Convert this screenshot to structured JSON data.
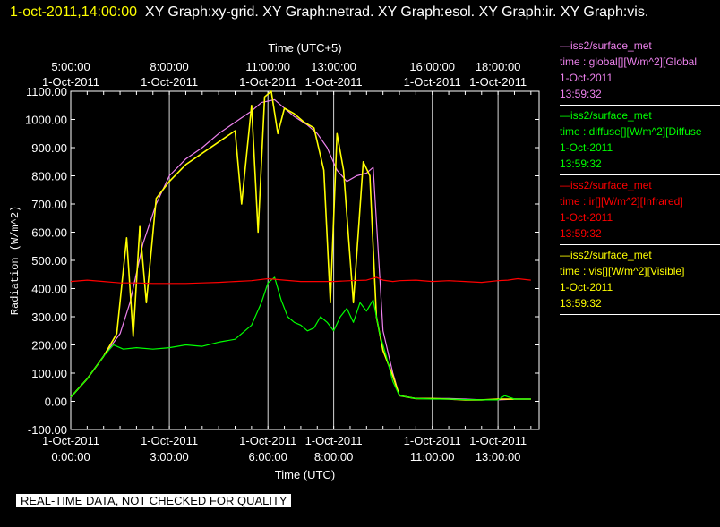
{
  "header": {
    "timestamp": "1-oct-2011,14:00:00",
    "graphs": "XY Graph:xy-grid.  XY Graph:netrad.  XY Graph:esol.  XY Graph:ir.  XY Graph:vis."
  },
  "colors": {
    "global": "#ee82ee",
    "diffuse": "#00ff00",
    "ir": "#ff0000",
    "vis": "#ffff00",
    "grid": "#ffffff",
    "background": "#000000"
  },
  "legend": [
    {
      "source": "—iss2/surface_met",
      "field": "time : global[][W/m^2][Global",
      "date": "1-Oct-2011",
      "time": "13:59:32"
    },
    {
      "source": "—iss2/surface_met",
      "field": "time : diffuse[][W/m^2][Diffuse",
      "date": "1-Oct-2011",
      "time": "13:59:32"
    },
    {
      "source": "—iss2/surface_met",
      "field": "time : ir[][W/m^2][Infrared]",
      "date": "1-Oct-2011",
      "time": "13:59:32"
    },
    {
      "source": "—iss2/surface_met",
      "field": "time : vis[][W/m^2][Visible]",
      "date": "1-Oct-2011",
      "time": "13:59:32"
    }
  ],
  "footer": "REAL-TIME DATA, NOT CHECKED FOR QUALITY",
  "chart_data": {
    "type": "line",
    "top_axis_title": "Time (UTC+5)",
    "xlabel": "Time (UTC)",
    "ylabel": "Radiation (W/m^2)",
    "ylim": [
      -100,
      1100
    ],
    "yticks": [
      "1100.00",
      "1000.00",
      "900.00",
      "800.00",
      "700.00",
      "600.00",
      "500.00",
      "400.00",
      "300.00",
      "200.00",
      "100.00",
      "0.00",
      "-100.00"
    ],
    "ytick_values": [
      1100,
      1000,
      900,
      800,
      700,
      600,
      500,
      400,
      300,
      200,
      100,
      0,
      -100
    ],
    "xlim_hours": [
      0,
      14.25
    ],
    "bottom_ticks": [
      {
        "h": 0,
        "date": "1-Oct-2011",
        "time": "0:00:00"
      },
      {
        "h": 3,
        "date": "1-Oct-2011",
        "time": "3:00:00"
      },
      {
        "h": 6,
        "date": "1-Oct-2011",
        "time": "6:00:00"
      },
      {
        "h": 8,
        "date": "1-Oct-2011",
        "time": "8:00:00"
      },
      {
        "h": 11,
        "date": "1-Oct-2011",
        "time": "11:00:00"
      },
      {
        "h": 13,
        "date": "1-Oct-2011",
        "time": "13:00:00"
      }
    ],
    "top_ticks": [
      {
        "h": 0,
        "time": "5:00:00",
        "date": "1-Oct-2011"
      },
      {
        "h": 3,
        "time": "8:00:00",
        "date": "1-Oct-2011"
      },
      {
        "h": 6,
        "time": "11:00:00",
        "date": "1-Oct-2011"
      },
      {
        "h": 8,
        "time": "13:00:00",
        "date": "1-Oct-2011"
      },
      {
        "h": 11,
        "time": "16:00:00",
        "date": "1-Oct-2011"
      },
      {
        "h": 13,
        "time": "18:00:00",
        "date": "1-Oct-2011"
      }
    ],
    "grid": true,
    "series": [
      {
        "name": "global",
        "color": "#ee82ee",
        "x": [
          0,
          0.5,
          1,
          1.5,
          1.8,
          2.2,
          2.6,
          3,
          3.5,
          4,
          4.5,
          5,
          5.5,
          5.8,
          6.2,
          6.5,
          6.8,
          7.2,
          7.5,
          7.8,
          8.1,
          8.4,
          8.7,
          9,
          9.2,
          9.5,
          9.8,
          10,
          10.5,
          11,
          11.5,
          12,
          12.5,
          13,
          13.5,
          14
        ],
        "y": [
          15,
          80,
          160,
          240,
          350,
          560,
          700,
          800,
          860,
          900,
          950,
          990,
          1030,
          1060,
          1070,
          1040,
          1010,
          980,
          950,
          900,
          820,
          780,
          800,
          810,
          830,
          250,
          100,
          20,
          10,
          10,
          10,
          8,
          5,
          5,
          8,
          8
        ]
      },
      {
        "name": "diffuse",
        "color": "#00ff00",
        "x": [
          0,
          0.5,
          1,
          1.3,
          1.6,
          2,
          2.5,
          3,
          3.5,
          4,
          4.5,
          5,
          5.5,
          5.8,
          6.0,
          6.2,
          6.4,
          6.6,
          6.8,
          7.0,
          7.2,
          7.4,
          7.6,
          7.8,
          8.0,
          8.2,
          8.4,
          8.6,
          8.8,
          9.0,
          9.2,
          9.4,
          9.6,
          9.8,
          10,
          10.5,
          11,
          11.5,
          12,
          12.5,
          13,
          13.2,
          13.5,
          14
        ],
        "y": [
          15,
          80,
          160,
          200,
          185,
          190,
          185,
          190,
          200,
          195,
          210,
          220,
          270,
          350,
          420,
          440,
          360,
          300,
          280,
          270,
          250,
          260,
          300,
          280,
          250,
          300,
          330,
          280,
          350,
          320,
          360,
          240,
          160,
          70,
          20,
          10,
          8,
          8,
          6,
          5,
          5,
          20,
          8,
          8
        ]
      },
      {
        "name": "ir",
        "color": "#ff0000",
        "x": [
          0,
          0.5,
          1,
          1.5,
          2,
          2.5,
          3,
          3.5,
          4,
          4.5,
          5,
          5.5,
          6,
          6.5,
          7,
          7.5,
          8,
          8.5,
          9,
          9.3,
          9.5,
          9.8,
          10,
          10.5,
          11,
          11.5,
          12,
          12.5,
          13,
          13.3,
          13.6,
          14
        ],
        "y": [
          425,
          430,
          425,
          420,
          420,
          418,
          418,
          418,
          420,
          422,
          425,
          428,
          435,
          430,
          425,
          425,
          425,
          428,
          430,
          440,
          430,
          425,
          428,
          430,
          425,
          428,
          425,
          422,
          428,
          430,
          435,
          430
        ]
      },
      {
        "name": "vis",
        "color": "#ffff00",
        "x": [
          0,
          0.5,
          1,
          1.4,
          1.7,
          1.9,
          2.1,
          2.3,
          2.6,
          3,
          3.5,
          4,
          4.5,
          5,
          5.2,
          5.5,
          5.7,
          5.9,
          6.1,
          6.3,
          6.5,
          6.8,
          7.1,
          7.4,
          7.7,
          7.9,
          8.1,
          8.3,
          8.6,
          8.9,
          9.1,
          9.3,
          9.5,
          9.8,
          10,
          10.5,
          11,
          11.5,
          12,
          12.5,
          13,
          13.5,
          14
        ],
        "y": [
          15,
          80,
          160,
          240,
          580,
          230,
          620,
          350,
          720,
          780,
          840,
          880,
          920,
          960,
          700,
          1050,
          600,
          1080,
          1100,
          950,
          1040,
          1020,
          990,
          970,
          820,
          350,
          950,
          820,
          350,
          850,
          800,
          300,
          180,
          90,
          20,
          10,
          10,
          8,
          5,
          5,
          8,
          8,
          8
        ]
      }
    ]
  }
}
